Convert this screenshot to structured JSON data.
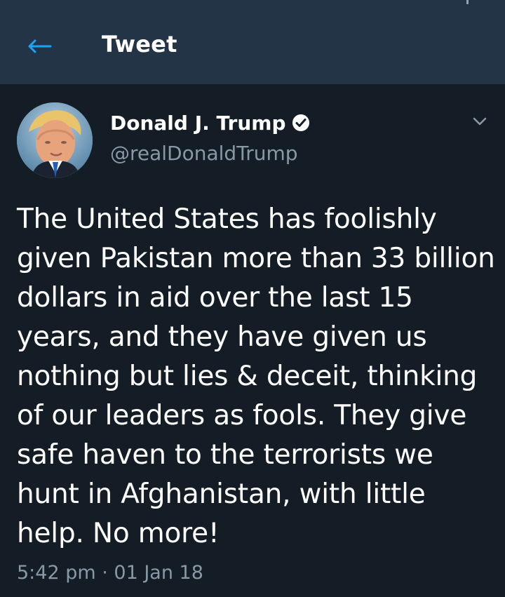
{
  "header": {
    "title": "Tweet",
    "back_icon": "back-arrow-icon",
    "accent_color": "#1da1f2"
  },
  "tweet": {
    "author": {
      "name": "Donald J. Trump",
      "handle": "@realDonaldTrump",
      "verified": true,
      "avatar_icon": "profile-avatar"
    },
    "text": "The United States has foolishly given Pakistan more than 33 billion dollars in aid over the last 15 years, and they have given us nothing but lies & deceit, thinking of our leaders as fools. They give safe haven to the terrorists we hunt in Afghanistan, with little help. No more!",
    "timestamp": "5:42 pm · 01 Jan 18",
    "menu_icon": "chevron-down-icon"
  },
  "colors": {
    "page_bg": "#141d26",
    "header_bg": "#243447",
    "secondary_text": "#8899a6",
    "primary_text": "#ffffff"
  }
}
